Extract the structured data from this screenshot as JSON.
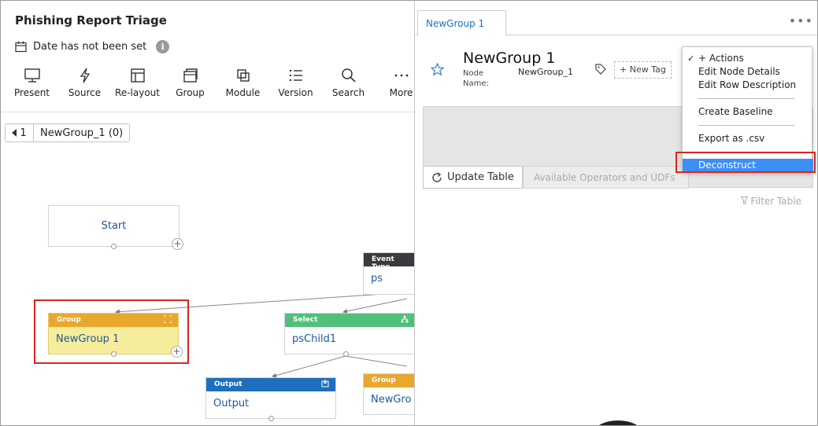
{
  "header": {
    "title": "Phishing Report Triage",
    "date_status": "Date has not been set",
    "info_glyph": "i"
  },
  "toolbar": {
    "items": [
      {
        "label": "Present",
        "icon": "monitor-icon"
      },
      {
        "label": "Source",
        "icon": "lightning-icon"
      },
      {
        "label": "Re-layout",
        "icon": "layout-icon"
      },
      {
        "label": "Group",
        "icon": "group-icon"
      },
      {
        "label": "Module",
        "icon": "module-icon"
      },
      {
        "label": "Version",
        "icon": "list-icon"
      },
      {
        "label": "Search",
        "icon": "search-icon"
      },
      {
        "label": "More",
        "icon": "more-icon"
      }
    ]
  },
  "breadcrumb": {
    "back_count": "1",
    "label": "NewGroup_1 (0)"
  },
  "canvas": {
    "start_node": {
      "label": "Start"
    },
    "event_node": {
      "type": "Event Type",
      "label": "ps"
    },
    "group_node": {
      "type": "Group",
      "label": "NewGroup 1"
    },
    "select_node": {
      "type": "Select",
      "label": "psChild1"
    },
    "output_node": {
      "type": "Output",
      "label": "Output"
    },
    "group_node_2": {
      "type": "Group",
      "label": "NewGro"
    },
    "plus_glyph": "+"
  },
  "details": {
    "tab_label": "NewGroup 1",
    "more_glyph": "•••",
    "node_title": "NewGroup 1",
    "node_name_label": "Node Name:",
    "node_name_value": "NewGroup_1",
    "new_tag_label": "+ New Tag",
    "update_table_label": "Update Table",
    "operators_label": "Available Operators and UDFs",
    "filter_table_label": "Filter Table"
  },
  "actions_menu": {
    "check": "✓",
    "title": "+ Actions",
    "items": [
      "Edit Node Details",
      "Edit Row Description",
      "Create Baseline",
      "Export as .csv",
      "Deconstruct"
    ]
  },
  "colors": {
    "group_header": "#e8a82e",
    "group_body": "#f6ed9c",
    "select_header": "#52c07b",
    "output_header": "#1f6fbd",
    "event_header": "#3b3b3f",
    "highlight": "#d9261c",
    "menu_selected": "#3e8ef7"
  }
}
